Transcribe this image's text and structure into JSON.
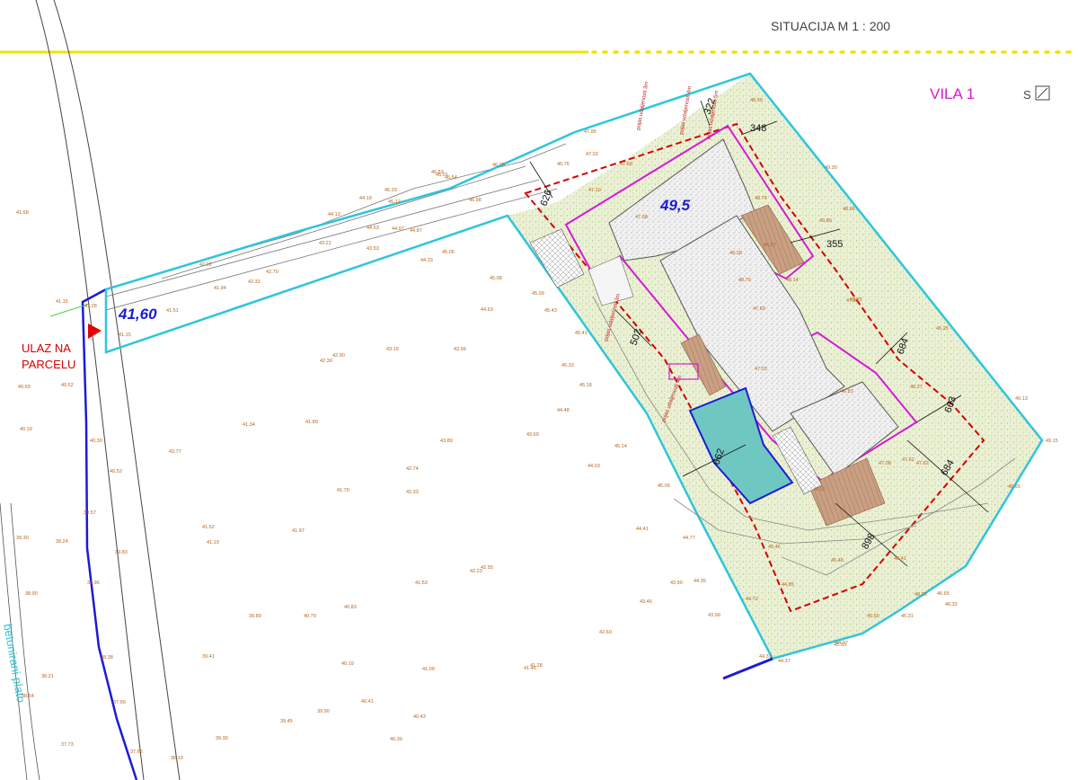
{
  "drawing": {
    "title": "SITUACIJA  M 1 : 200",
    "building_name": "VILA 1",
    "north_label": "S",
    "entrance_label_line1": "ULAZ NA",
    "entrance_label_line2": "PARCELU",
    "road_label": "betonirani plato",
    "level_access": "41,60",
    "level_house": "49,5"
  },
  "dimensions": [
    "322",
    "348",
    "626",
    "355",
    "502",
    "684",
    "663",
    "662",
    "684",
    "898"
  ],
  "setback_notes": [
    "pojas udaljenosti 3m",
    "pojas udaljenosti 4m",
    "pojas udaljenosti 5m",
    "pojas udaljenosti 3m",
    "pojas udaljenosti 4m"
  ],
  "spot_heights": [
    "41.58",
    "41.15",
    "41.28",
    "41.51",
    "41.15",
    "40.69",
    "40.52",
    "40.19",
    "40.30",
    "40.52",
    "39.57",
    "39.24",
    "39.30",
    "39.83",
    "38.90",
    "38.96",
    "38.38",
    "38.21",
    "38.54",
    "37.99",
    "37.73",
    "37.66",
    "36.19",
    "42.02",
    "41.94",
    "42.32",
    "42.70",
    "43.21",
    "43.53",
    "44.13",
    "44.19",
    "44.53",
    "44.97",
    "44.87",
    "45.29",
    "45.12",
    "45.01",
    "46.53",
    "46.78",
    "46.54",
    "46.98",
    "47.95",
    "47.02",
    "46.76",
    "47.68",
    "47.10",
    "44.33",
    "45.06",
    "43.15",
    "42.90",
    "42.39",
    "43.99",
    "44.63",
    "45.08",
    "45.09",
    "45.43",
    "45.41",
    "45.33",
    "45.18",
    "44.48",
    "43.89",
    "43.69",
    "41.34",
    "41.89",
    "42.74",
    "42.33",
    "41.70",
    "43.77",
    "41.52",
    "41.97",
    "41.19",
    "42.23",
    "42.55",
    "40.83",
    "41.53",
    "39.89",
    "40.79",
    "39.41",
    "40.19",
    "41.09",
    "41.46",
    "41.28",
    "40.41",
    "40.43",
    "39.90",
    "39.45",
    "39.30",
    "40.30",
    "44.03",
    "45.14",
    "45.05",
    "44.41",
    "44.77",
    "43.90",
    "44.35",
    "43.46",
    "43.99",
    "42.60",
    "44.72",
    "45.46",
    "44.85",
    "45.48",
    "47.08",
    "48.74",
    "46.57",
    "48.28",
    "48.76",
    "47.69",
    "47.03",
    "46.83",
    "48.14",
    "47.38",
    "48.27",
    "49.89",
    "48.96",
    "49.75",
    "49.13",
    "49.15",
    "48.65",
    "47.62",
    "47.08",
    "46.52",
    "45.50",
    "46.29",
    "46.65",
    "46.32",
    "45.31",
    "45.33",
    "44.77",
    "44.31",
    "44.37",
    "48.99",
    "49.30",
    "45.25",
    "47.62",
    "48.41"
  ],
  "colors": {
    "parcel_boundary": "#2ec5dc",
    "road_boundary": "#1b1bd6",
    "building_outline": "#d61ad6",
    "setback_line": "#d40000",
    "north_border": "#f2e200",
    "vegetation": "#e7efd3",
    "pool": "#6fc7c2",
    "terrace": "#c49a7a",
    "spot_heights": "#b5651d"
  }
}
